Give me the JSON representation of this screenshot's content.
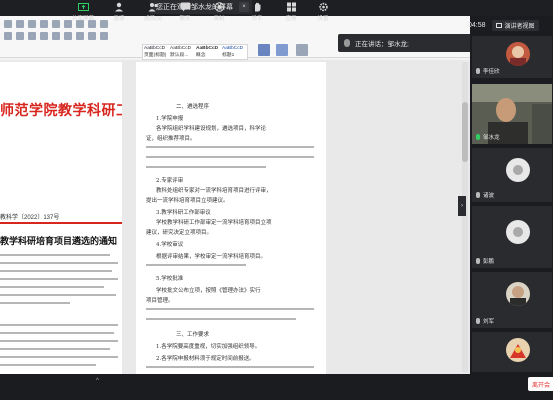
{
  "notice": {
    "text": "您正在观看邹水龙的屏幕",
    "close": "×"
  },
  "header": {
    "time": "04:58",
    "gallery_label": "演讲者视图"
  },
  "speaking": {
    "text": "正在讲话：邹水龙;"
  },
  "document": {
    "styles": [
      {
        "preview": "AaBbCcD",
        "name": "页面(标题)"
      },
      {
        "preview": "AaBbCcD",
        "name": "默认段..."
      },
      {
        "preview": "AaBbCcD",
        "name": "概念"
      },
      {
        "preview": "AaBbCcD",
        "name": "标题1"
      }
    ],
    "left_page": {
      "red_title": "师范学院教学科研工作部",
      "doc_number": "教科学〔2022〕137号",
      "notice_title": "教学科研培育项目遴选的通知"
    },
    "right_page": {
      "lines": [
        "二、遴选程序",
        "1.学院申报",
        "各学院组织学科建设规划，遴选项目，科学论",
        "证，组织推荐项目。",
        "2.专家评审",
        "教科处组织专家对一流学科培育项目进行评审，",
        "提出一流学科培育项目立项建议。",
        "3.教学科研工作部审议",
        "学校教学科研工作部审定一流学科培育项目立项",
        "建议，研究决定立项项目。",
        "4.学校审议",
        "根据评审结果，学校审定一流学科培育项目。",
        "5.学校批准",
        "学校批文公布立项，按照《管理办法》实行",
        "项目管理。",
        "三、工作要求",
        "1.各学院要高度重视，切实加强组织领导。",
        "2.各学院申报材料须于规定时间前报送。"
      ]
    }
  },
  "participants": [
    {
      "name": "李佳欣",
      "mic": "muted",
      "kind": "photo"
    },
    {
      "name": "邹水龙",
      "mic": "active",
      "kind": "video"
    },
    {
      "name": "诸波",
      "mic": "muted",
      "kind": "generic"
    },
    {
      "name": "彭鹏",
      "mic": "muted",
      "kind": "generic"
    },
    {
      "name": "刘军",
      "mic": "muted",
      "kind": "photo"
    },
    {
      "name": "",
      "mic": "muted",
      "kind": "photo"
    }
  ],
  "toolbar": {
    "share": "共享屏幕",
    "invite": "邀请",
    "members": "成员(9)",
    "chat": "聊天",
    "record": "录制",
    "raise_hand": "举手",
    "apps": "应用",
    "settings": "设置",
    "leave": "离开会"
  },
  "colors": {
    "accent": "#d7261e",
    "active_mic": "#2fcf64",
    "leave": "#e53935"
  }
}
